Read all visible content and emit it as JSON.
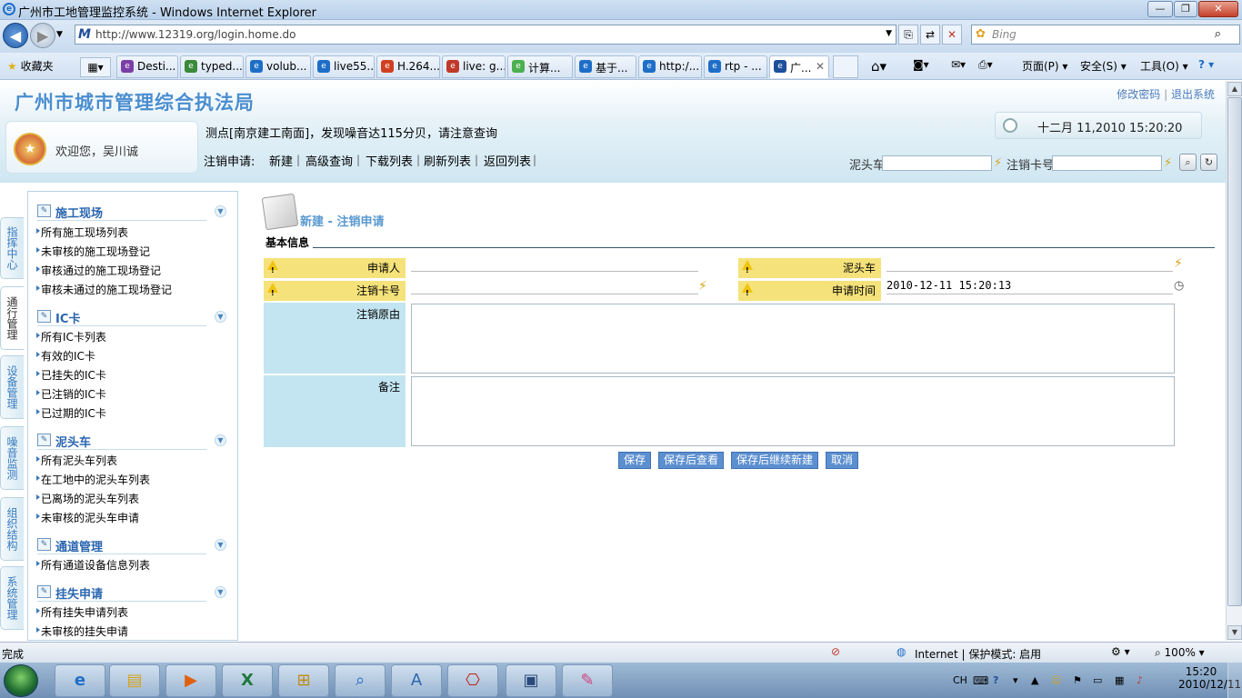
{
  "window": {
    "title": "广州市工地管理监控系统 - Windows Internet Explorer",
    "min_label": "—",
    "max_label": "❐",
    "close_label": "✕"
  },
  "browser": {
    "back": "◀",
    "forward": "▶",
    "url": "http://www.12319.org/login.home.do",
    "search_placeholder": "Bing",
    "favorites_label": "收藏夹",
    "tabs": [
      {
        "label": "Desti...",
        "color": "#7b3ea6"
      },
      {
        "label": "typed...",
        "color": "#3a8a3a"
      },
      {
        "label": "volub...",
        "color": "#1e6ec8"
      },
      {
        "label": "live55...",
        "color": "#1e6ec8"
      },
      {
        "label": "H.264...",
        "color": "#d04020"
      },
      {
        "label": "live: g...",
        "color": "#c0392b"
      },
      {
        "label": "计算...",
        "color": "#4caf50"
      },
      {
        "label": "基于...",
        "color": "#1e6ec8"
      },
      {
        "label": "http:/...",
        "color": "#1e6ec8"
      },
      {
        "label": "rtp - ...",
        "color": "#1e6ec8"
      },
      {
        "label": "广...",
        "color": "#1d4f9a"
      }
    ],
    "commands": {
      "page": "页面(P)",
      "safety": "安全(S)",
      "tools": "工具(O)",
      "help": "?"
    }
  },
  "site": {
    "title": "广州市城市管理综合执法局",
    "change_password": "修改密码",
    "logout": "退出系统",
    "welcome": "欢迎您，吴川诚",
    "alert": "测点[南京建工南面]，发现噪音达115分贝，请注意查询",
    "clock": "十二月 11,2010 15:20:20"
  },
  "menu": {
    "title": "注销申请:",
    "items": [
      "新建",
      "高级查询",
      "下载列表",
      "刷新列表",
      "返回列表"
    ],
    "search_truck_label": "泥头车",
    "search_card_label": "注销卡号"
  },
  "vtabs": [
    "指挥中心",
    "通行管理",
    "设备管理",
    "噪音监测",
    "组织结构",
    "系统管理"
  ],
  "nav": {
    "groups": [
      {
        "title": "施工现场",
        "items": [
          "所有施工现场列表",
          "未审核的施工现场登记",
          "审核通过的施工现场登记",
          "审核未通过的施工现场登记"
        ]
      },
      {
        "title": "IC卡",
        "items": [
          "所有IC卡列表",
          "有效的IC卡",
          "已挂失的IC卡",
          "已注销的IC卡",
          "已过期的IC卡"
        ]
      },
      {
        "title": "泥头车",
        "items": [
          "所有泥头车列表",
          "在工地中的泥头车列表",
          "已离场的泥头车列表",
          "未审核的泥头车申请"
        ]
      },
      {
        "title": "通道管理",
        "items": [
          "所有通道设备信息列表"
        ]
      },
      {
        "title": "挂失申请",
        "items": [
          "所有挂失申请列表",
          "未审核的挂失申请"
        ]
      }
    ]
  },
  "form": {
    "header": "新建 - 注销申请",
    "section": "基本信息",
    "applicant_label": "申请人",
    "applicant_value": "",
    "truck_label": "泥头车",
    "truck_value": "",
    "card_label": "注销卡号",
    "card_value": "",
    "time_label": "申请时间",
    "time_value": "2010-12-11 15:20:13",
    "reason_label": "注销原由",
    "note_label": "备注",
    "buttons": {
      "save": "保存",
      "save_view": "保存后查看",
      "save_new": "保存后继续新建",
      "cancel": "取消"
    }
  },
  "status": {
    "left": "完成",
    "zone": "Internet | 保护模式: 启用",
    "zoom": "100%"
  },
  "taskbar": {
    "lang": "CH",
    "time": "15:20",
    "date": "2010/12/11"
  }
}
